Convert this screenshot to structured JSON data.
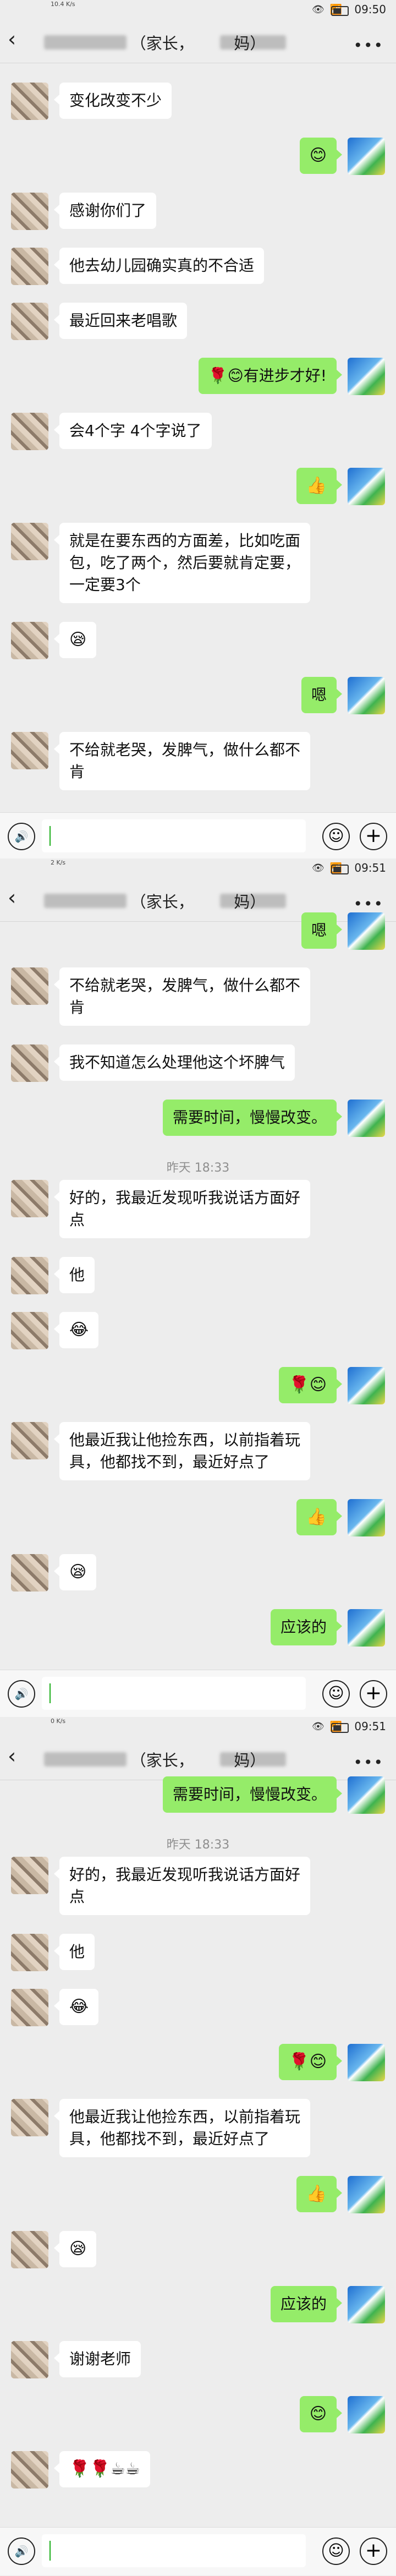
{
  "screens": [
    {
      "status": {
        "network": "10.4\nK/s",
        "time": "09:50"
      },
      "title": "（家长，　　　妈）",
      "messages": [
        {
          "side": "in",
          "text": "变化改变不少"
        },
        {
          "side": "out",
          "text": "😊"
        },
        {
          "side": "in",
          "text": "感谢你们了"
        },
        {
          "side": "in",
          "text": "他去幼儿园确实真的不合适"
        },
        {
          "side": "in",
          "text": "最近回来老唱歌"
        },
        {
          "side": "out",
          "text": "🌹😊有进步才好!"
        },
        {
          "side": "in",
          "text": "会4个字 4个字说了"
        },
        {
          "side": "out",
          "text": "👍"
        },
        {
          "side": "in",
          "text": "就是在要东西的方面差，比如吃面\n包，吃了两个，然后要就肯定要，\n一定要3个"
        },
        {
          "side": "in",
          "text": "😪"
        },
        {
          "side": "out",
          "text": "嗯"
        },
        {
          "side": "in",
          "text": "不给就老哭，发脾气，做什么都不\n肯"
        }
      ]
    },
    {
      "status": {
        "network": "2\nK/s",
        "time": "09:51"
      },
      "title": "（家长，　　　妈）",
      "messages": [
        {
          "side": "out",
          "text": "嗯"
        },
        {
          "side": "in",
          "text": "不给就老哭，发脾气，做什么都不\n肯"
        },
        {
          "side": "in",
          "text": "我不知道怎么处理他这个坏脾气"
        },
        {
          "side": "out",
          "text": "需要时间，慢慢改变。"
        },
        {
          "side": "time",
          "text": "昨天 18:33"
        },
        {
          "side": "in",
          "text": "好的，我最近发现听我说话方面好\n点"
        },
        {
          "side": "in",
          "text": "他"
        },
        {
          "side": "in",
          "text": "😂"
        },
        {
          "side": "out",
          "text": "🌹😊"
        },
        {
          "side": "in",
          "text": "他最近我让他捡东西，以前指着玩\n具，他都找不到，最近好点了"
        },
        {
          "side": "out",
          "text": "👍"
        },
        {
          "side": "in",
          "text": "😪"
        },
        {
          "side": "out",
          "text": "应该的"
        }
      ]
    },
    {
      "status": {
        "network": "0\nK/s",
        "time": "09:51"
      },
      "title": "（家长，　　　妈）",
      "messages": [
        {
          "side": "out",
          "text": "需要时间，慢慢改变。"
        },
        {
          "side": "time",
          "text": "昨天 18:33"
        },
        {
          "side": "in",
          "text": "好的，我最近发现听我说话方面好\n点"
        },
        {
          "side": "in",
          "text": "他"
        },
        {
          "side": "in",
          "text": "😂"
        },
        {
          "side": "out",
          "text": "🌹😊"
        },
        {
          "side": "in",
          "text": "他最近我让他捡东西，以前指着玩\n具，他都找不到，最近好点了"
        },
        {
          "side": "out",
          "text": "👍"
        },
        {
          "side": "in",
          "text": "😪"
        },
        {
          "side": "out",
          "text": "应该的"
        },
        {
          "side": "in",
          "text": "谢谢老师"
        },
        {
          "side": "out",
          "text": "😊"
        },
        {
          "side": "in",
          "text": "🌹🌹☕☕"
        }
      ]
    }
  ],
  "ui": {
    "back_icon": "‹",
    "menu_icon": "•••",
    "voice_icon": "🔊",
    "emoji_icon": "☺",
    "plus_icon": "+",
    "status_icons": "👁 📶"
  }
}
